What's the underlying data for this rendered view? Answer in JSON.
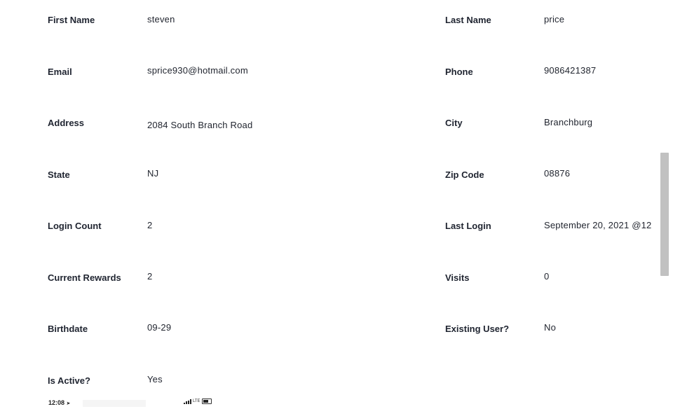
{
  "fields": {
    "first_name": {
      "label": "First Name",
      "value": "steven"
    },
    "last_name": {
      "label": "Last Name",
      "value": "price"
    },
    "email": {
      "label": "Email",
      "value": "sprice930@hotmail.com"
    },
    "phone": {
      "label": "Phone",
      "value": "9086421387"
    },
    "address": {
      "label": "Address",
      "value": "2084 South Branch Road"
    },
    "city": {
      "label": "City",
      "value": "Branchburg"
    },
    "state": {
      "label": "State",
      "value": "NJ"
    },
    "zip": {
      "label": "Zip Code",
      "value": "08876"
    },
    "login_count": {
      "label": "Login Count",
      "value": "2"
    },
    "last_login": {
      "label": "Last Login",
      "value": "September 20, 2021 @12"
    },
    "current_rewards": {
      "label": "Current Rewards",
      "value": "2"
    },
    "visits": {
      "label": "Visits",
      "value": "0"
    },
    "birthdate": {
      "label": "Birthdate",
      "value": "09-29"
    },
    "existing_user": {
      "label": "Existing User?",
      "value": "No"
    },
    "is_active": {
      "label": "Is Active?",
      "value": "Yes"
    }
  },
  "status_bar": {
    "time": "12:08",
    "location_icon": "location-arrow-icon",
    "network": "LTE",
    "signal_icon": "signal-bars-icon",
    "battery_icon": "battery-icon"
  },
  "scrollbar": {
    "position_fraction": 0.37
  }
}
